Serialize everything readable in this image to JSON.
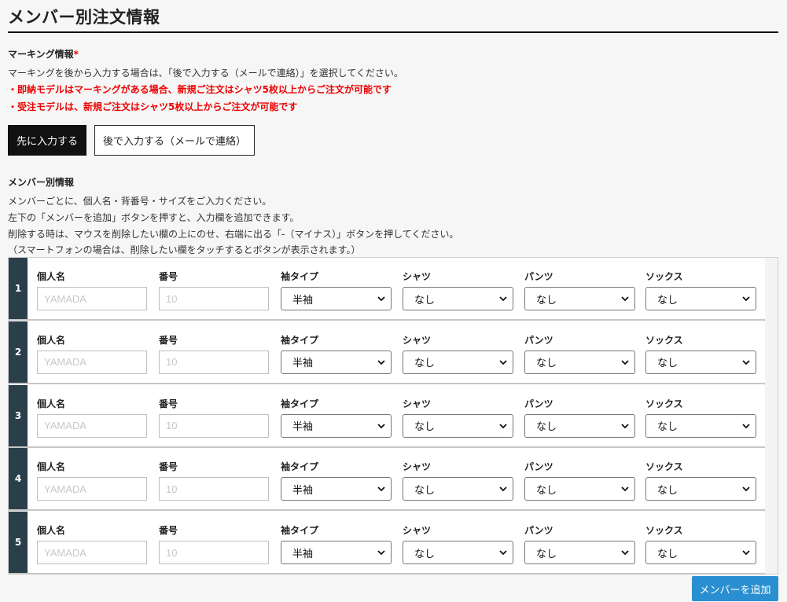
{
  "page": {
    "title": "メンバー別注文情報"
  },
  "marking": {
    "label": "マーキング情報",
    "required_mark": "*",
    "note": "マーキングを後から入力する場合は、「後で入力する（メールで連絡）」を選択してください。",
    "warnings": [
      "・即納モデルはマーキングがある場合、新規ご注文はシャツ5枚以上からご注文が可能です",
      "・受注モデルは、新規ご注文はシャツ5枚以上からご注文が可能です"
    ],
    "options": [
      {
        "label": "先に入力する",
        "selected": true
      },
      {
        "label": "後で入力する（メールで連絡）",
        "selected": false
      }
    ]
  },
  "members_section": {
    "label": "メンバー別情報",
    "notes": [
      "メンバーごとに、個人名・背番号・サイズをご入力ください。",
      "左下の「メンバーを追加」ボタンを押すと、入力欄を追加できます。",
      "削除する時は、マウスを削除したい欄の上にのせ、右端に出る「-（マイナス）」ボタンを押してください。",
      "（スマートフォンの場合は、削除したい欄をタッチするとボタンが表示されます。）"
    ],
    "field_labels": {
      "name": "個人名",
      "number": "番号",
      "sleeve": "袖タイプ",
      "shirt": "シャツ",
      "pants": "パンツ",
      "socks": "ソックス"
    },
    "placeholders": {
      "name": "YAMADA",
      "number": "10"
    },
    "rows": [
      {
        "num": "1",
        "sleeve": "半袖",
        "shirt": "なし",
        "pants": "なし",
        "socks": "なし"
      },
      {
        "num": "2",
        "sleeve": "半袖",
        "shirt": "なし",
        "pants": "なし",
        "socks": "なし"
      },
      {
        "num": "3",
        "sleeve": "半袖",
        "shirt": "なし",
        "pants": "なし",
        "socks": "なし"
      },
      {
        "num": "4",
        "sleeve": "半袖",
        "shirt": "なし",
        "pants": "なし",
        "socks": "なし"
      },
      {
        "num": "5",
        "sleeve": "半袖",
        "shirt": "なし",
        "pants": "なし",
        "socks": "なし"
      }
    ],
    "add_button": "メンバーを追加"
  },
  "colors": {
    "row_number_bg": "#2b3f4b",
    "warning": "#e00000",
    "add_button": "#2a8fd0",
    "selected_option": "#111111"
  }
}
